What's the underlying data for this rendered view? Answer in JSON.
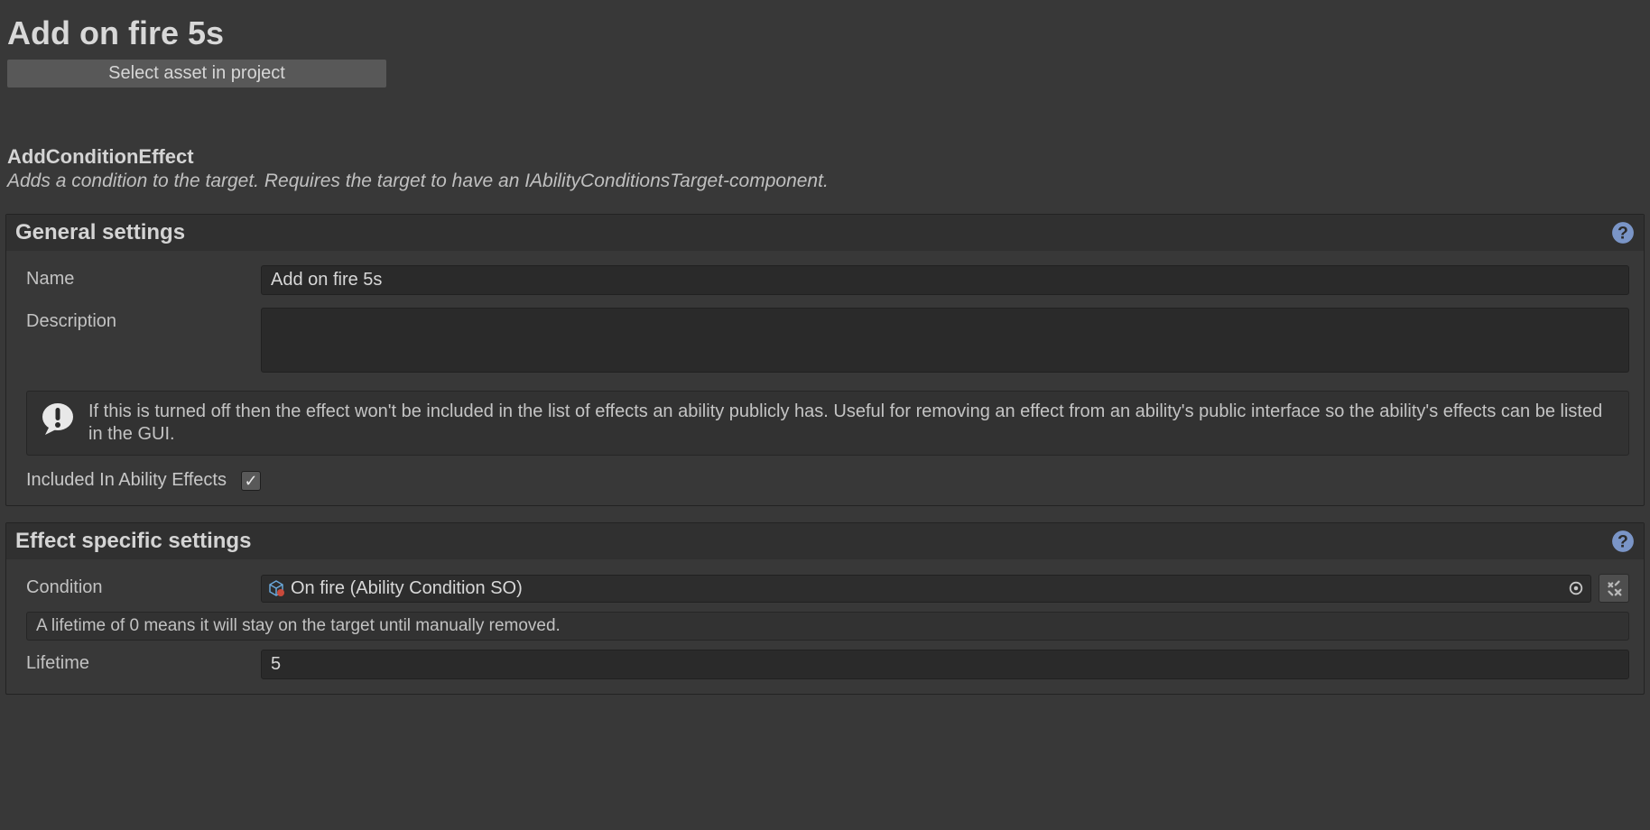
{
  "header": {
    "title": "Add on fire 5s",
    "select_asset_label": "Select asset in project"
  },
  "effect": {
    "class_name": "AddConditionEffect",
    "description": "Adds a condition to the target. Requires the target to have an IAbilityConditionsTarget-component."
  },
  "general": {
    "title": "General settings",
    "name_label": "Name",
    "name_value": "Add on fire 5s",
    "description_label": "Description",
    "description_value": "",
    "info_text": "If this is turned off then the effect won't be included in the list of effects an ability publicly has. Useful for removing an effect from an ability's public interface so the ability's effects can be listed in the GUI.",
    "included_label": "Included In Ability Effects",
    "included_checked": true
  },
  "specific": {
    "title": "Effect specific settings",
    "condition_label": "Condition",
    "condition_value": "On fire (Ability Condition SO)",
    "lifetime_hint": "A lifetime of 0 means it will stay on the target until manually removed.",
    "lifetime_label": "Lifetime",
    "lifetime_value": "5"
  }
}
